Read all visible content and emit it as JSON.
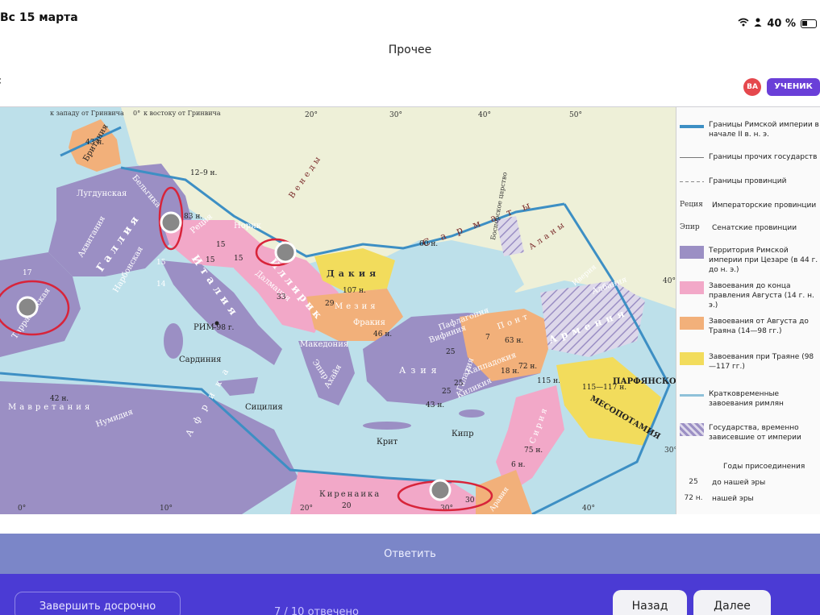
{
  "status": {
    "date": "Вс 15 марта",
    "battery": "40 %"
  },
  "header": {
    "title": "Прочее",
    "avatar_initials": "ВА",
    "role": "УЧЕНИК"
  },
  "map": {
    "top_label_west": "к западу от Гринвича",
    "top_label_zero": "0°",
    "top_label_east": "к востоку от Гринвича",
    "degrees": {
      "d20": "20°",
      "d30": "30°",
      "d40": "40°",
      "d50": "50°",
      "d0": "0°",
      "d10": "10°",
      "d20b": "20°",
      "d30b": "30°",
      "d40b": "40°",
      "d40r": "40°",
      "d30r": "30°"
    },
    "regions": {
      "britain": "Британия",
      "gallia": "Галлия",
      "lugdun": "Лугдунская",
      "belgica": "Бельгика",
      "akvitania": "Аквитания",
      "narbon": "Нарбонская",
      "raetia": "Реция",
      "norik": "Норик",
      "italia": "Италия",
      "illyrik": "Иллирик",
      "dalmatia": "Далмация",
      "mesia": "Мезия",
      "dakia": "Дакия",
      "frakia": "Фракия",
      "makedonia": "Македония",
      "epir": "Эпир",
      "akhaya": "Ахайя",
      "asia": "Азия",
      "vifinia": "Вифиния",
      "paflagonia": "Пафлагония",
      "pont": "Понт",
      "galatia": "Галатия",
      "kappadokia": "Каппадокия",
      "kilikia": "Киликия",
      "siria": "Сирия",
      "armenia": "Армения",
      "albania": "Албания",
      "iveria": "Иверия",
      "parfia": "ПАРФЯНСКОЕ ЦАРСТВО",
      "mesopotamia": "МЕСОПОТАМИЯ",
      "venedy": "Венеды",
      "sarmaty": "Сарматы",
      "alany": "Аланы",
      "bospor": "Боспорское царство",
      "mavretania": "Мавретания",
      "numidia": "Нумидия",
      "afrika": "Африка",
      "kirenaika": "Киренаика",
      "aravia": "Аравия",
      "tarrakon": "Тарраконская",
      "rim": "РИМ",
      "sardinia": "Сардиния",
      "sicilia": "Сицилия",
      "krit": "Крит",
      "kipr": "Кипр"
    },
    "years": {
      "y43": "43 н.",
      "y12_9": "12–9 н.",
      "y83": "83 н.",
      "y15a": "15",
      "y15b": "15",
      "y15c": "15",
      "y15d": "15",
      "y14": "14",
      "y17": "17",
      "y33": "33",
      "y29": "29",
      "y107": "107 н.",
      "y46": "46 н.",
      "y60": "60 н.",
      "y25a": "25",
      "y25b": "25",
      "y25c": "25",
      "y7": "7",
      "y63": "63 н.",
      "y18": "18 н.",
      "y72": "72 н.",
      "y115": "115 н.",
      "y115_117": "115—117 н.",
      "y43b": "43 н.",
      "y75": "75 н.",
      "y6": "6 н.",
      "y42": "42 н.",
      "y20": "20",
      "y30": "30",
      "y98": "–98 г."
    }
  },
  "legend": [
    {
      "kind": "line",
      "color": "#3d8fc4",
      "label": "Границы Римской империи в начале II в. н. э."
    },
    {
      "kind": "line",
      "color": "#777777",
      "label": "Границы прочих государств"
    },
    {
      "kind": "line",
      "color": "#888888",
      "label": "Границы провинций"
    },
    {
      "kind": "word",
      "word": "Реция",
      "label": "Императорские провинции"
    },
    {
      "kind": "word",
      "word": "Эпир",
      "label": "Сенатские провинции"
    },
    {
      "kind": "swatch",
      "color": "#9b8fc4",
      "label": "Территория Римской империи при Цезаре (в 44 г. до н. э.)"
    },
    {
      "kind": "swatch",
      "color": "#f2a8c8",
      "label": "Завоевания до конца правления Августа (14 г. н. э.)"
    },
    {
      "kind": "swatch",
      "color": "#f2b07a",
      "label": "Завоевания от Августа до Траяна (14—98 гг.)"
    },
    {
      "kind": "swatch",
      "color": "#f2dc5c",
      "label": "Завоевания при Траяне (98—117 гг.)"
    },
    {
      "kind": "line",
      "color": "#8fc1d9",
      "label": "Кратковременные завоевания римлян"
    },
    {
      "kind": "hatch",
      "color": "#b8aed0",
      "label": "Государства, временно зависевшие от империи"
    },
    {
      "kind": "text",
      "label": "Годы присоединения"
    },
    {
      "kind": "year",
      "word": "25",
      "label": "до нашей эры"
    },
    {
      "kind": "year",
      "word": "72 н.",
      "label": "нашей эры"
    }
  ],
  "actions": {
    "answer": "Ответить",
    "finish": "Завершить досрочно",
    "progress": "7 / 10 отвечено",
    "prev": "Назад",
    "next": "Далее"
  },
  "colors": {
    "sea": "#bde0ea",
    "land": "#eef0d8",
    "caesar": "#9b8fc4",
    "augustus": "#f2a8c8",
    "to_trajan": "#f2b07a",
    "trajan": "#f2dc5c",
    "border": "#3d8fc4",
    "accent": "#6a3fd8",
    "marker_ring": "#d8243a"
  }
}
